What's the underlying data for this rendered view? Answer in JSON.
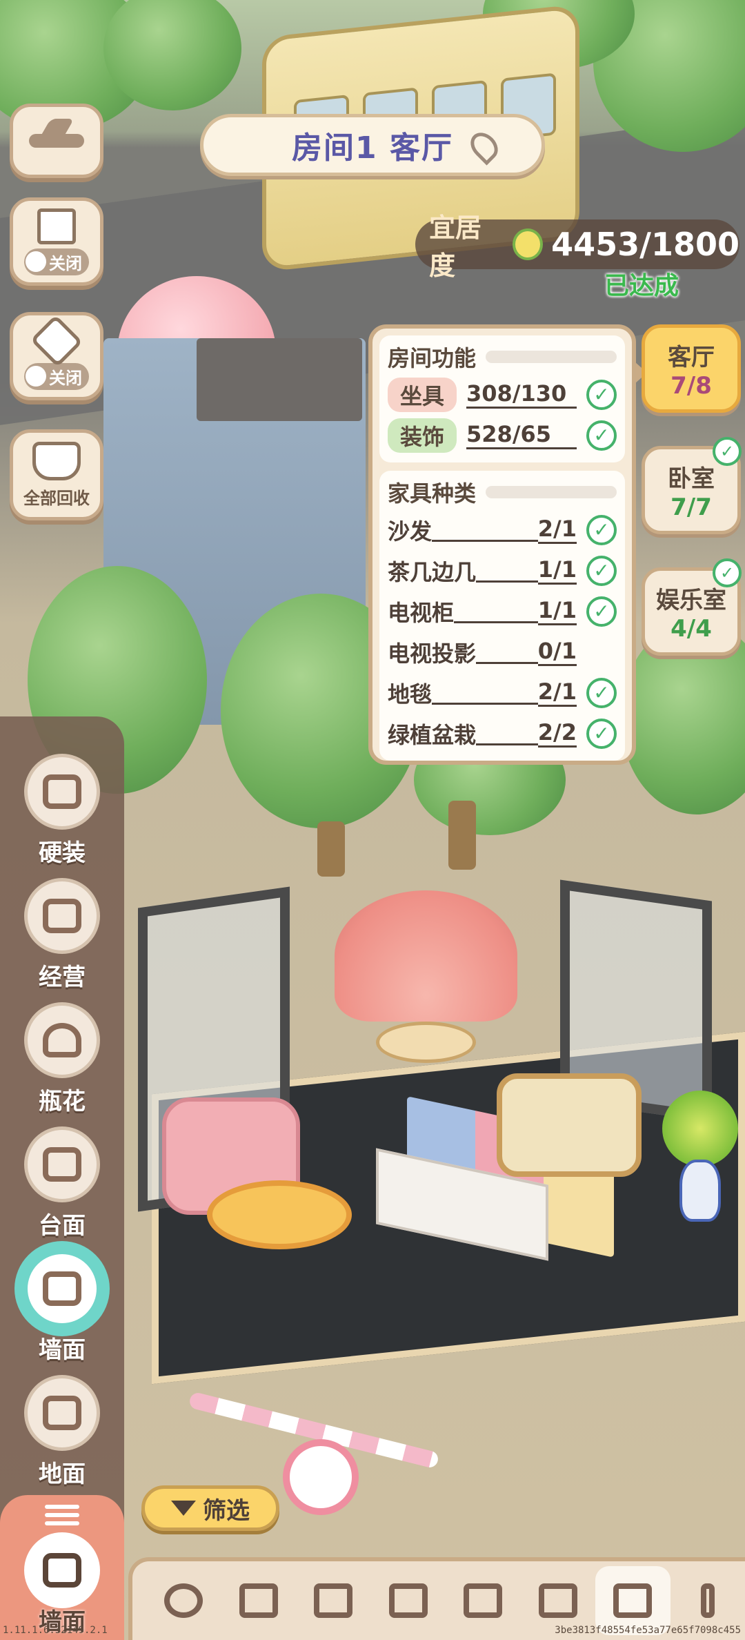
{
  "header": {
    "room_title": "房间1 客厅",
    "livability_label": "宜居度",
    "livability_value": "4453/1800",
    "achieved_label": "已达成"
  },
  "left_tools": {
    "back_icon": "back-arrow-icon",
    "toggle1_label": "关闭",
    "toggle2_label": "关闭",
    "recycle_label": "全部回收"
  },
  "info_panel": {
    "room_function_title": "房间功能",
    "functions": [
      {
        "name": "坐具",
        "count": "308/130",
        "done": true
      },
      {
        "name": "装饰",
        "count": "528/65",
        "done": true
      }
    ],
    "furniture_title": "家具种类",
    "furniture": [
      {
        "name": "沙发",
        "count": "2/1",
        "done": true
      },
      {
        "name": "茶几边几",
        "count": "1/1",
        "done": true
      },
      {
        "name": "电视柜",
        "count": "1/1",
        "done": true
      },
      {
        "name": "电视投影",
        "count": "0/1",
        "done": false
      },
      {
        "name": "地毯",
        "count": "2/1",
        "done": true
      },
      {
        "name": "绿植盆栽",
        "count": "2/2",
        "done": true
      }
    ]
  },
  "room_tabs": [
    {
      "name": "客厅",
      "count": "7/8",
      "active": true
    },
    {
      "name": "卧室",
      "count": "7/7",
      "active": false
    },
    {
      "name": "娱乐室",
      "count": "4/4",
      "active": false
    }
  ],
  "categories": [
    {
      "label": "硬装"
    },
    {
      "label": "经营"
    },
    {
      "label": "瓶花"
    },
    {
      "label": "台面"
    },
    {
      "label": "墙面"
    },
    {
      "label": "地面"
    }
  ],
  "bottom_category": {
    "label": "墙面"
  },
  "filter_label": "筛选",
  "footer": {
    "version": "1.11.1.6.32149.2.1",
    "hash": "3be3813f48554fe53a77e65f7098c455"
  },
  "colors": {
    "accent_yellow": "#fbd46a",
    "check_green": "#45b26b",
    "panel_bg": "#f6ead8",
    "title_purple": "#5a58a6"
  }
}
